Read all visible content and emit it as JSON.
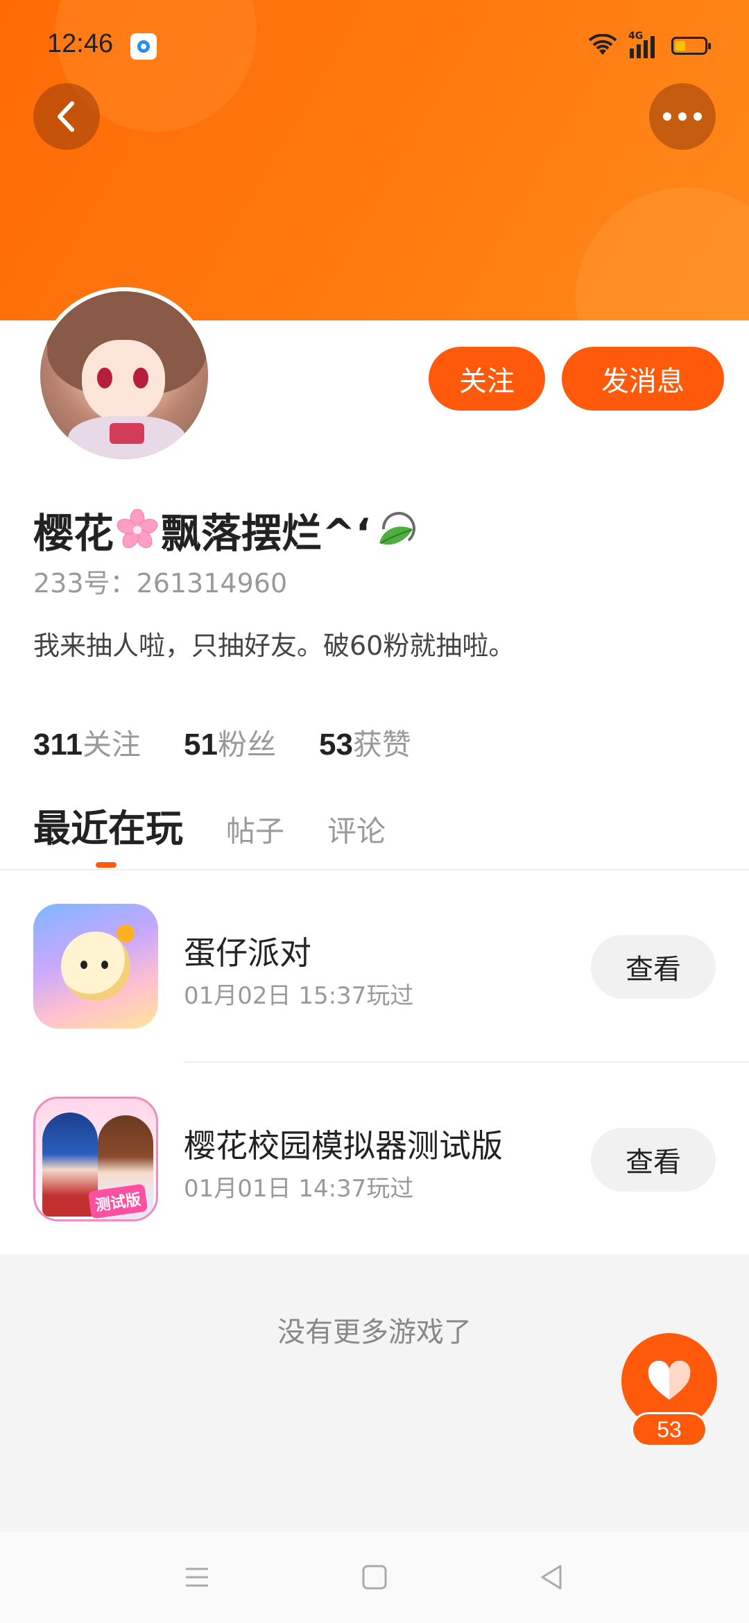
{
  "status_bar": {
    "time": "12:46",
    "network_label": "4G",
    "icons": [
      "app-notification-icon",
      "wifi-icon",
      "signal-icon",
      "battery-icon"
    ]
  },
  "header": {
    "back_icon": "chevron-left-icon",
    "more_icon": "more-dots-icon",
    "gradient_colors": [
      "#ff6a06",
      "#ff8a1c"
    ]
  },
  "profile": {
    "username_part1": "樱花",
    "username_part2": "飘落摆烂^‘",
    "user_id": "233号：261314960",
    "bio": "我来抽人啦，只抽好友。破60粉就抽啦。",
    "follow_label": "关注",
    "message_label": "发消息"
  },
  "stats": [
    {
      "num": "311",
      "label": "关注"
    },
    {
      "num": "51",
      "label": "粉丝"
    },
    {
      "num": "53",
      "label": "获赞"
    }
  ],
  "tabs": [
    {
      "label": "最近在玩",
      "active": true
    },
    {
      "label": "帖子",
      "active": false
    },
    {
      "label": "评论",
      "active": false
    }
  ],
  "games": [
    {
      "title": "蛋仔派对",
      "played": "01月02日 15:37玩过",
      "action": "查看"
    },
    {
      "title": "樱花校园模拟器测试版",
      "played": "01月01日 14:37玩过",
      "action": "查看",
      "badge": "测试版"
    }
  ],
  "footer": {
    "no_more": "没有更多游戏了",
    "like_count": "53"
  },
  "accent_color": "#ff5a0c"
}
